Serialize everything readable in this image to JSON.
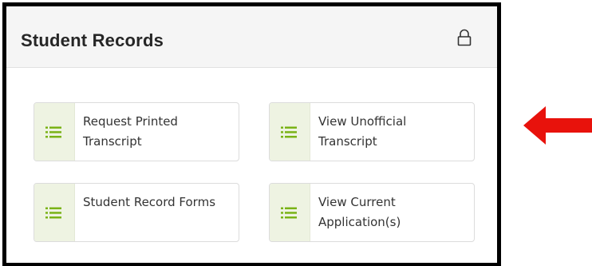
{
  "card": {
    "title": "Student Records",
    "lock_icon": "lock-icon"
  },
  "tiles": [
    {
      "label": "Request Printed Transcript",
      "icon": "list-icon"
    },
    {
      "label": "View Unofficial Transcript",
      "icon": "list-icon"
    },
    {
      "label": "Student Record Forms",
      "icon": "list-icon"
    },
    {
      "label": "View Current Application(s)",
      "icon": "list-icon"
    }
  ],
  "annotation": {
    "arrow_icon": "red-arrow-left-icon",
    "arrow_color": "#e8120c"
  },
  "colors": {
    "icon_green": "#7ab317",
    "icon_bg": "#eef3e2",
    "header_bg": "#f5f5f5"
  }
}
